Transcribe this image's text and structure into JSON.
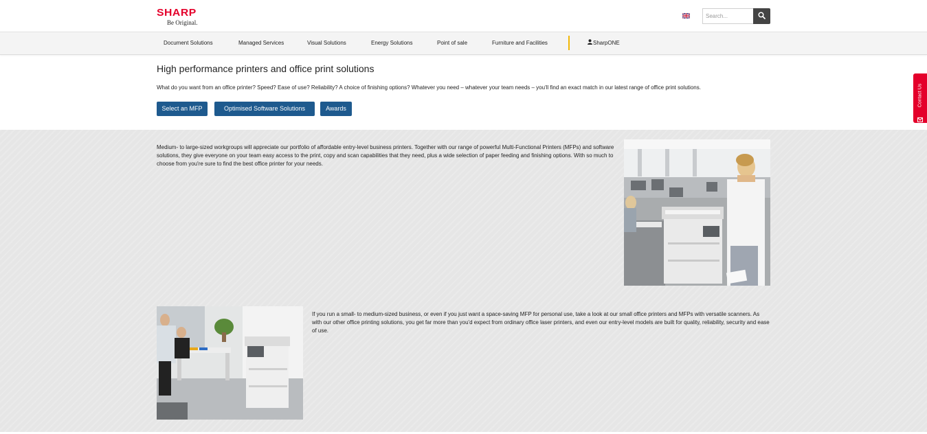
{
  "header": {
    "brand": "SHARP",
    "tagline": "Be Original.",
    "search": {
      "placeholder": "Search...",
      "value": ""
    },
    "language_icon": "uk-flag-icon",
    "search_icon": "search-icon"
  },
  "nav": {
    "items": [
      {
        "label": "Document Solutions"
      },
      {
        "label": "Managed Services"
      },
      {
        "label": "Visual Solutions"
      },
      {
        "label": "Energy Solutions"
      },
      {
        "label": "Point of sale"
      },
      {
        "label": "Furniture and Facilities"
      },
      {
        "label": "SharpONE"
      }
    ]
  },
  "intro": {
    "title": "High performance printers and office print solutions",
    "text": "What do you want from an office printer? Speed? Ease of use? Reliability? A choice of finishing options? Whatever you need – whatever your team needs – you'll find an exact match in our latest range of office print solutions.",
    "buttons": [
      {
        "label": "Select an MFP"
      },
      {
        "label": "Optimised Software Solutions"
      },
      {
        "label": "Awards"
      }
    ]
  },
  "contact_tab": {
    "label": "Contact Us"
  },
  "content": {
    "paragraph1": "Medium- to large-sized workgroups will appreciate our portfolio of affordable entry-level business printers. Together with our range of powerful Multi-Functional Printers (MFPs) and software solutions, they give everyone on your team easy access to the print, copy and scan capabilities that they need, plus a wide selection of paper feeding and finishing options. With so much to choose from you're sure to find the best office printer for your needs.",
    "paragraph2": "If you run a small- to medium-sized business, or even if you just want a space-saving MFP for personal use, take a look at our small office printers and MFPs with versatile scanners. As with our other office printing solutions, you get far more than you'd expect from ordinary office laser printers, and even our entry-level models are built for quality, reliability, security and ease of use."
  },
  "colors": {
    "brand_red": "#e4002b",
    "button_blue": "#1e5a8e",
    "nav_separator": "#f2b705",
    "band_grey": "#e6e6e6"
  }
}
